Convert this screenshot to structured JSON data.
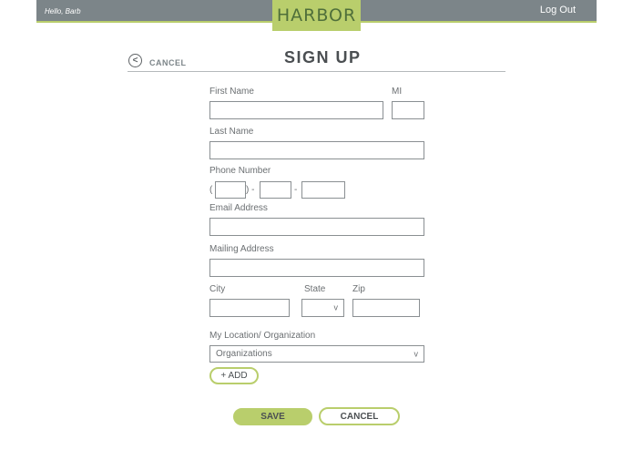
{
  "header": {
    "greeting": "Hello, Barb",
    "logo": "HARBOR",
    "logout": "Log Out",
    "bar_color": "#7c8589",
    "accent_color": "#b9ce6c"
  },
  "page": {
    "back_label": "CANCEL",
    "back_icon": "<",
    "title": "SIGN UP"
  },
  "form": {
    "first_name_label": "First Name",
    "mi_label": "MI",
    "last_name_label": "Last Name",
    "phone_label": "Phone Number",
    "phone_open": "(",
    "phone_close": ") -",
    "phone_dash": "-",
    "email_label": "Email Address",
    "mailing_label": "Mailing Address",
    "city_label": "City",
    "state_label": "State",
    "zip_label": "Zip",
    "state_chevron": "v",
    "location_label": "My Location/ Organization",
    "location_selected": "Organizations",
    "location_chevron": "v",
    "add_label": "+ ADD"
  },
  "actions": {
    "save_label": "SAVE",
    "cancel_label": "CANCEL"
  }
}
